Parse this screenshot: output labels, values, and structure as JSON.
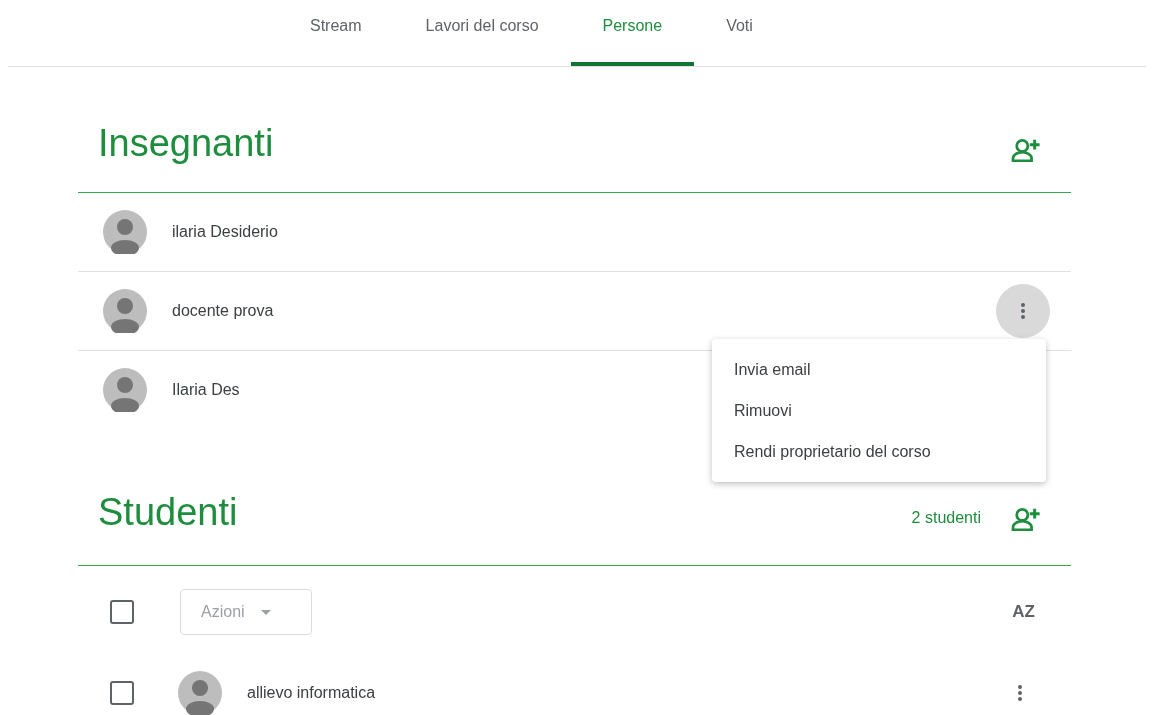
{
  "tabs": [
    {
      "label": "Stream",
      "selected": false
    },
    {
      "label": "Lavori del corso",
      "selected": false
    },
    {
      "label": "Persone",
      "selected": true
    },
    {
      "label": "Voti",
      "selected": false
    }
  ],
  "teachers": {
    "title": "Insegnanti",
    "people": [
      {
        "name": "ilaria Desiderio",
        "menu_open": false
      },
      {
        "name": "docente prova",
        "menu_open": true
      },
      {
        "name": "Ilaria Des",
        "menu_open": false
      }
    ]
  },
  "menu": {
    "items": [
      "Invia email",
      "Rimuovi",
      "Rendi proprietario del corso"
    ]
  },
  "students": {
    "title": "Studenti",
    "count": "2 studenti",
    "select_all_checked": false,
    "actions": {
      "label": "Azioni",
      "disabled": true
    },
    "sort_label": "AZ",
    "people": [
      {
        "name": "allievo informatica",
        "checked": false
      }
    ]
  }
}
